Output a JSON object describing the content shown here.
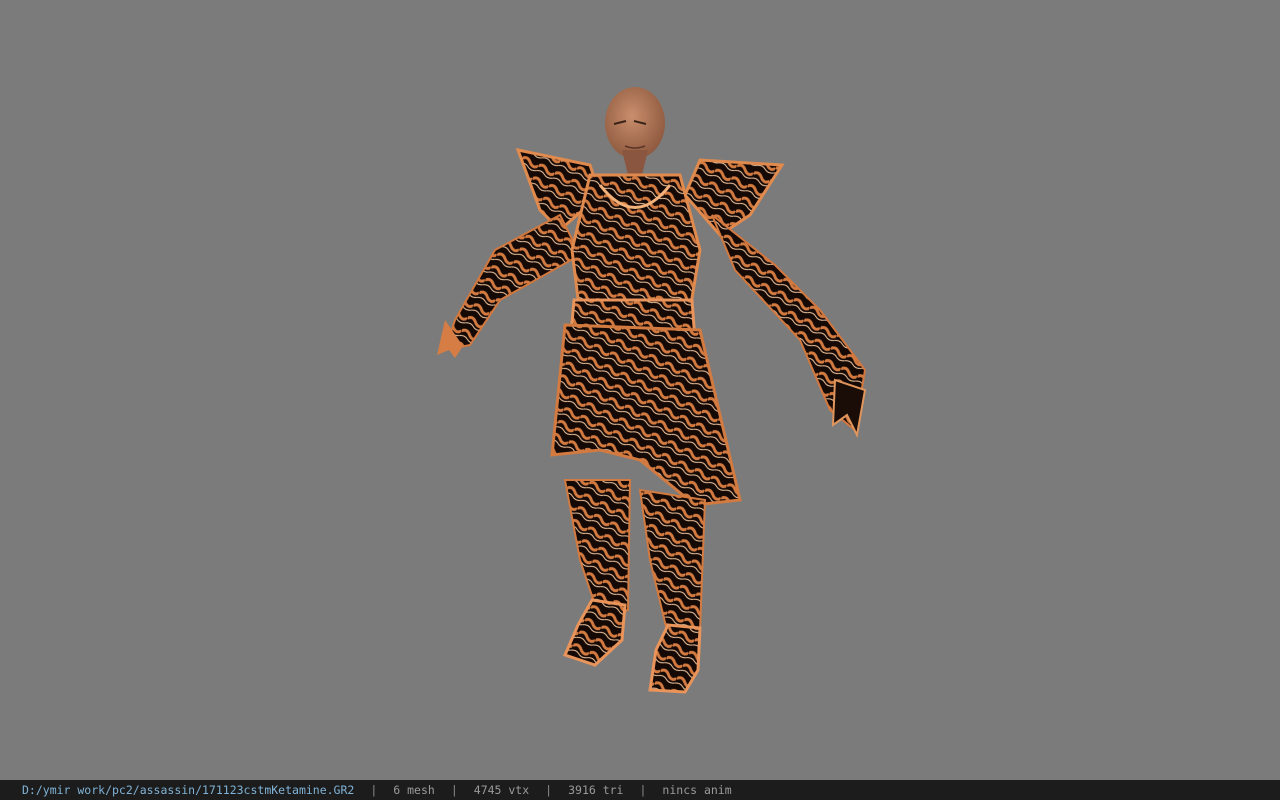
{
  "window": {
    "background_color": "#7b7b7b"
  },
  "viewport": {
    "model_name": "171123cstmKetamine",
    "model_description": "assassin character in bronze-and-black ornate armor, T-pose",
    "colors": {
      "armor_bronze": "#c8703a",
      "armor_dark": "#1a0d08",
      "armor_highlight": "#f0c7a0",
      "skin": "#b07a5c"
    }
  },
  "statusbar": {
    "file_path": "D:/ymir work/pc2/assassin/171123cstmKetamine.GR2",
    "mesh": "6 mesh",
    "vtx": "4745 vtx",
    "tri": "3916 tri",
    "anim": "nincs anim",
    "separator": "|",
    "colors": {
      "background": "#1c1c1c",
      "path": "#7fb2d6",
      "text": "#9a9a9a"
    }
  }
}
